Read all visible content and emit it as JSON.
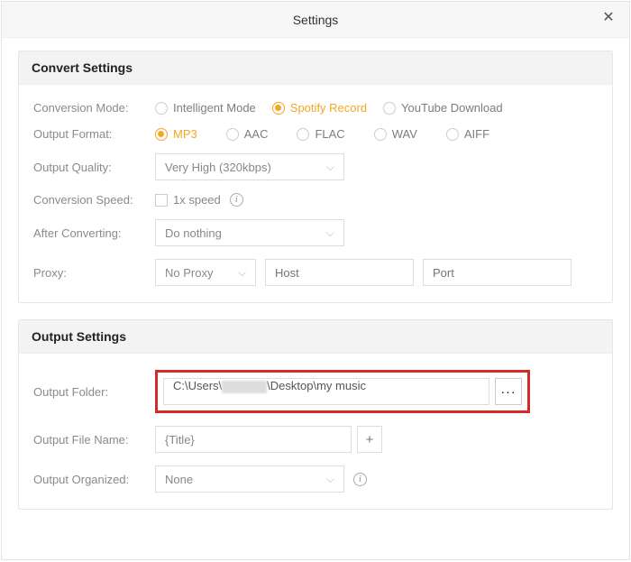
{
  "header": {
    "title": "Settings",
    "close": "✕"
  },
  "convert": {
    "panel_title": "Convert Settings",
    "mode_label": "Conversion Mode:",
    "modes": [
      "Intelligent Mode",
      "Spotify Record",
      "YouTube Download"
    ],
    "mode_selected": "Spotify Record",
    "format_label": "Output Format:",
    "formats": [
      "MP3",
      "AAC",
      "FLAC",
      "WAV",
      "AIFF"
    ],
    "format_selected": "MP3",
    "quality_label": "Output Quality:",
    "quality_value": "Very High (320kbps)",
    "speed_label": "Conversion Speed:",
    "speed_value": "1x speed",
    "after_label": "After Converting:",
    "after_value": "Do nothing",
    "proxy_label": "Proxy:",
    "proxy_value": "No Proxy",
    "host_placeholder": "Host",
    "port_placeholder": "Port"
  },
  "output": {
    "panel_title": "Output Settings",
    "folder_label": "Output Folder:",
    "folder_prefix": "C:\\Users\\",
    "folder_suffix": "\\Desktop\\my music",
    "browse_btn": "···",
    "filename_label": "Output File Name:",
    "filename_value": "{Title}",
    "plus_btn": "+",
    "organized_label": "Output Organized:",
    "organized_value": "None"
  }
}
